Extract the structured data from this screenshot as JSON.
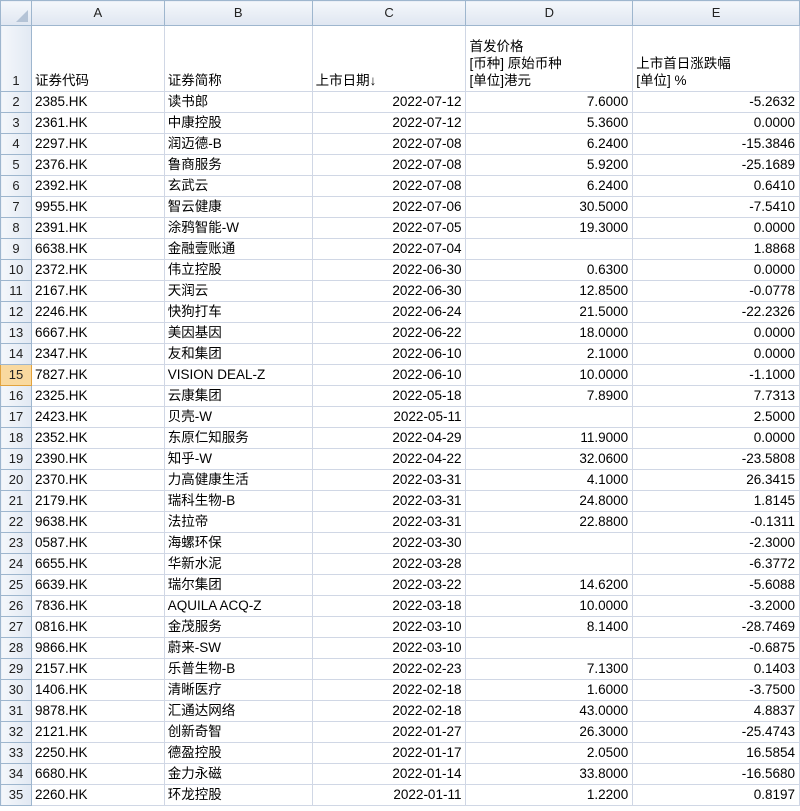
{
  "columns": [
    "A",
    "B",
    "C",
    "D",
    "E"
  ],
  "header_row": {
    "num": "1",
    "a": "证券代码",
    "b": "证券简称",
    "c": "上市日期↓",
    "d_line1": "首发价格",
    "d_line2": "[币种] 原始币种",
    "d_line3": "[单位]港元",
    "e_line1": "上市首日涨跌幅",
    "e_line2": "[单位] %"
  },
  "selected_row": "15",
  "rows": [
    {
      "num": "2",
      "code": "2385.HK",
      "name": "读书郎",
      "date": "2022-07-12",
      "price": "7.6000",
      "chg": "-5.2632"
    },
    {
      "num": "3",
      "code": "2361.HK",
      "name": "中康控股",
      "date": "2022-07-12",
      "price": "5.3600",
      "chg": "0.0000"
    },
    {
      "num": "4",
      "code": "2297.HK",
      "name": "润迈德-B",
      "date": "2022-07-08",
      "price": "6.2400",
      "chg": "-15.3846"
    },
    {
      "num": "5",
      "code": "2376.HK",
      "name": "鲁商服务",
      "date": "2022-07-08",
      "price": "5.9200",
      "chg": "-25.1689"
    },
    {
      "num": "6",
      "code": "2392.HK",
      "name": "玄武云",
      "date": "2022-07-08",
      "price": "6.2400",
      "chg": "0.6410"
    },
    {
      "num": "7",
      "code": "9955.HK",
      "name": "智云健康",
      "date": "2022-07-06",
      "price": "30.5000",
      "chg": "-7.5410"
    },
    {
      "num": "8",
      "code": "2391.HK",
      "name": "涂鸦智能-W",
      "date": "2022-07-05",
      "price": "19.3000",
      "chg": "0.0000"
    },
    {
      "num": "9",
      "code": "6638.HK",
      "name": "金融壹账通",
      "date": "2022-07-04",
      "price": "",
      "chg": "1.8868"
    },
    {
      "num": "10",
      "code": "2372.HK",
      "name": "伟立控股",
      "date": "2022-06-30",
      "price": "0.6300",
      "chg": "0.0000"
    },
    {
      "num": "11",
      "code": "2167.HK",
      "name": "天润云",
      "date": "2022-06-30",
      "price": "12.8500",
      "chg": "-0.0778"
    },
    {
      "num": "12",
      "code": "2246.HK",
      "name": "快狗打车",
      "date": "2022-06-24",
      "price": "21.5000",
      "chg": "-22.2326"
    },
    {
      "num": "13",
      "code": "6667.HK",
      "name": "美因基因",
      "date": "2022-06-22",
      "price": "18.0000",
      "chg": "0.0000"
    },
    {
      "num": "14",
      "code": "2347.HK",
      "name": "友和集团",
      "date": "2022-06-10",
      "price": "2.1000",
      "chg": "0.0000"
    },
    {
      "num": "15",
      "code": "7827.HK",
      "name": "VISION DEAL-Z",
      "date": "2022-06-10",
      "price": "10.0000",
      "chg": "-1.1000"
    },
    {
      "num": "16",
      "code": "2325.HK",
      "name": "云康集团",
      "date": "2022-05-18",
      "price": "7.8900",
      "chg": "7.7313"
    },
    {
      "num": "17",
      "code": "2423.HK",
      "name": "贝壳-W",
      "date": "2022-05-11",
      "price": "",
      "chg": "2.5000"
    },
    {
      "num": "18",
      "code": "2352.HK",
      "name": "东原仁知服务",
      "date": "2022-04-29",
      "price": "11.9000",
      "chg": "0.0000"
    },
    {
      "num": "19",
      "code": "2390.HK",
      "name": "知乎-W",
      "date": "2022-04-22",
      "price": "32.0600",
      "chg": "-23.5808"
    },
    {
      "num": "20",
      "code": "2370.HK",
      "name": "力高健康生活",
      "date": "2022-03-31",
      "price": "4.1000",
      "chg": "26.3415"
    },
    {
      "num": "21",
      "code": "2179.HK",
      "name": "瑞科生物-B",
      "date": "2022-03-31",
      "price": "24.8000",
      "chg": "1.8145"
    },
    {
      "num": "22",
      "code": "9638.HK",
      "name": "法拉帝",
      "date": "2022-03-31",
      "price": "22.8800",
      "chg": "-0.1311"
    },
    {
      "num": "23",
      "code": "0587.HK",
      "name": "海螺环保",
      "date": "2022-03-30",
      "price": "",
      "chg": "-2.3000"
    },
    {
      "num": "24",
      "code": "6655.HK",
      "name": "华新水泥",
      "date": "2022-03-28",
      "price": "",
      "chg": "-6.3772"
    },
    {
      "num": "25",
      "code": "6639.HK",
      "name": "瑞尔集团",
      "date": "2022-03-22",
      "price": "14.6200",
      "chg": "-5.6088"
    },
    {
      "num": "26",
      "code": "7836.HK",
      "name": "AQUILA ACQ-Z",
      "date": "2022-03-18",
      "price": "10.0000",
      "chg": "-3.2000"
    },
    {
      "num": "27",
      "code": "0816.HK",
      "name": "金茂服务",
      "date": "2022-03-10",
      "price": "8.1400",
      "chg": "-28.7469"
    },
    {
      "num": "28",
      "code": "9866.HK",
      "name": "蔚来-SW",
      "date": "2022-03-10",
      "price": "",
      "chg": "-0.6875"
    },
    {
      "num": "29",
      "code": "2157.HK",
      "name": "乐普生物-B",
      "date": "2022-02-23",
      "price": "7.1300",
      "chg": "0.1403"
    },
    {
      "num": "30",
      "code": "1406.HK",
      "name": "清晰医疗",
      "date": "2022-02-18",
      "price": "1.6000",
      "chg": "-3.7500"
    },
    {
      "num": "31",
      "code": "9878.HK",
      "name": "汇通达网络",
      "date": "2022-02-18",
      "price": "43.0000",
      "chg": "4.8837"
    },
    {
      "num": "32",
      "code": "2121.HK",
      "name": "创新奇智",
      "date": "2022-01-27",
      "price": "26.3000",
      "chg": "-25.4743"
    },
    {
      "num": "33",
      "code": "2250.HK",
      "name": "德盈控股",
      "date": "2022-01-17",
      "price": "2.0500",
      "chg": "16.5854"
    },
    {
      "num": "34",
      "code": "6680.HK",
      "name": "金力永磁",
      "date": "2022-01-14",
      "price": "33.8000",
      "chg": "-16.5680"
    },
    {
      "num": "35",
      "code": "2260.HK",
      "name": "环龙控股",
      "date": "2022-01-11",
      "price": "1.2200",
      "chg": "0.8197"
    }
  ]
}
